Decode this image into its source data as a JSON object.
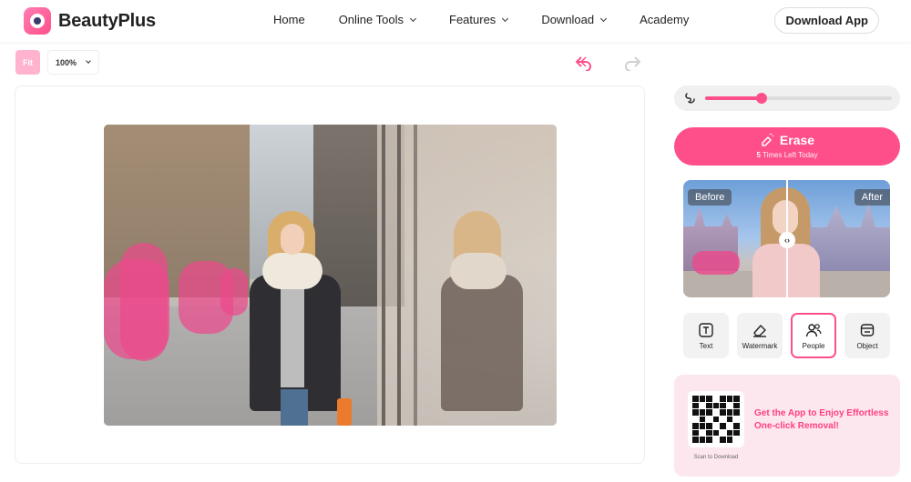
{
  "header": {
    "brand": "BeautyPlus",
    "nav": [
      {
        "label": "Home",
        "dropdown": false
      },
      {
        "label": "Online Tools",
        "dropdown": true
      },
      {
        "label": "Features",
        "dropdown": true
      },
      {
        "label": "Download",
        "dropdown": true
      },
      {
        "label": "Academy",
        "dropdown": false
      }
    ],
    "download_app": "Download App"
  },
  "toolbar": {
    "fit_label": "Fit",
    "zoom_value": "100%"
  },
  "brush": {
    "size_level": 0.3
  },
  "erase": {
    "label": "Erase",
    "remaining_count": "5",
    "remaining_suffix": "Times Left Today"
  },
  "compare": {
    "before": "Before",
    "after": "After"
  },
  "tools": [
    {
      "label": "Text",
      "icon": "text-icon",
      "active": false
    },
    {
      "label": "Watermark",
      "icon": "eraser-icon",
      "active": false
    },
    {
      "label": "People",
      "icon": "people-icon",
      "active": true
    },
    {
      "label": "Object",
      "icon": "object-icon",
      "active": false
    }
  ],
  "promo": {
    "scan": "Scan to Download",
    "text": "Get the App to Enjoy Effortless One-click Removal!"
  },
  "colors": {
    "accent": "#ff4f8b",
    "promo_bg": "#fde7ef",
    "mask": "#ec498c"
  }
}
